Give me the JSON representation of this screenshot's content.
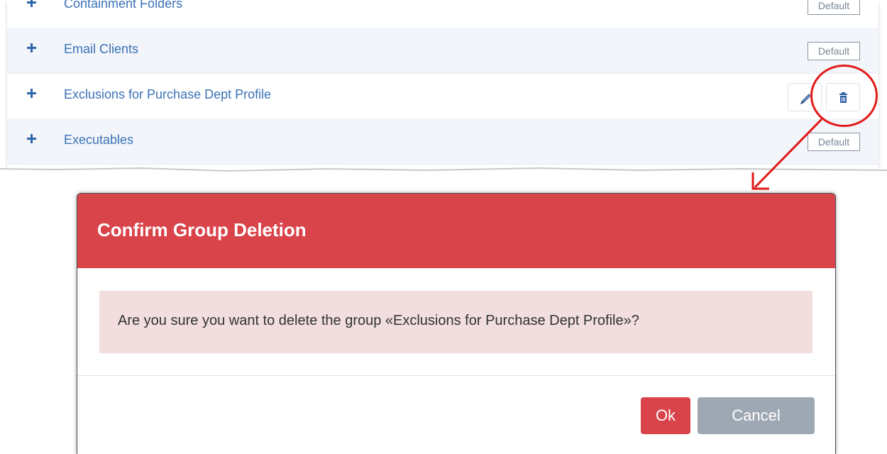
{
  "groups": [
    {
      "label": "Containment Folders",
      "badge": "Default"
    },
    {
      "label": "Email Clients",
      "badge": "Default"
    },
    {
      "label": "Exclusions for Purchase Dept Profile",
      "badge": ""
    },
    {
      "label": "Executables",
      "badge": "Default"
    }
  ],
  "row_actions": {
    "edit_icon": "pencil-icon",
    "delete_icon": "trash-icon"
  },
  "dialog": {
    "title": "Confirm Group Deletion",
    "message": "Are you sure you want to delete the group «Exclusions for Purchase Dept Profile»?",
    "ok_label": "Ok",
    "cancel_label": "Cancel"
  },
  "colors": {
    "header_red": "#d9434a",
    "alert_bg": "#f2dede",
    "cancel_gray": "#9ea8b3",
    "link_blue": "#3b72b8",
    "annotation_red": "#e11a1a"
  }
}
